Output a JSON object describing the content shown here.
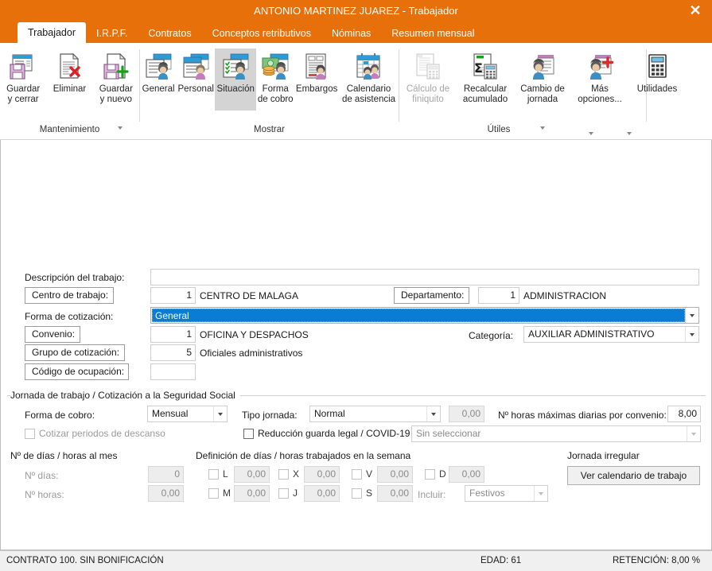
{
  "window": {
    "title": "ANTONIO MARTINEZ JUAREZ - Trabajador",
    "close_label": "✕",
    "accent_color": "#e8700a"
  },
  "tabs": [
    {
      "label": "Trabajador",
      "active": true
    },
    {
      "label": "I.R.P.F.",
      "active": false
    },
    {
      "label": "Contratos",
      "active": false
    },
    {
      "label": "Conceptos retributivos",
      "active": false
    },
    {
      "label": "Nóminas",
      "active": false
    },
    {
      "label": "Resumen mensual",
      "active": false
    }
  ],
  "ribbon": {
    "groups": [
      {
        "name": "Mantenimiento",
        "label": "Mantenimiento",
        "buttons": [
          {
            "id": "guardar-y-cerrar",
            "label": "Guardar\ny cerrar",
            "icon": "save-close-icon",
            "disabled": false,
            "selected": false,
            "dropdown": false
          },
          {
            "id": "eliminar",
            "label": "Eliminar",
            "icon": "delete-document-icon",
            "disabled": false,
            "selected": false,
            "dropdown": false
          },
          {
            "id": "guardar-y-nuevo",
            "label": "Guardar\ny nuevo",
            "icon": "save-new-icon",
            "disabled": false,
            "selected": false,
            "dropdown": true
          }
        ]
      },
      {
        "name": "Mostrar",
        "label": "Mostrar",
        "buttons": [
          {
            "id": "general",
            "label": "General",
            "icon": "person-card-icon",
            "disabled": false,
            "selected": false,
            "dropdown": false
          },
          {
            "id": "personal",
            "label": "Personal",
            "icon": "person-personal-icon",
            "disabled": false,
            "selected": false,
            "dropdown": false
          },
          {
            "id": "situacion",
            "label": "Situación",
            "icon": "person-checklist-icon",
            "disabled": false,
            "selected": true,
            "dropdown": false
          },
          {
            "id": "forma-de-cobro",
            "label": "Forma\nde cobro",
            "icon": "person-money-icon",
            "disabled": false,
            "selected": false,
            "dropdown": false
          },
          {
            "id": "embargos",
            "label": "Embargos",
            "icon": "embargo-doc-icon",
            "disabled": false,
            "selected": false,
            "dropdown": false
          },
          {
            "id": "calendario-de-asistencia",
            "label": "Calendario\nde asistencia",
            "icon": "calendar-people-icon",
            "disabled": false,
            "selected": false,
            "dropdown": false
          }
        ]
      },
      {
        "name": "Utiles",
        "label": "Útiles",
        "buttons": [
          {
            "id": "calculo-de-finiquito",
            "label": "Cálculo de\nfiniquito",
            "icon": "calc-doc-icon",
            "disabled": true,
            "selected": false,
            "dropdown": false
          },
          {
            "id": "recalcular-acumulado",
            "label": "Recalcular\nacumulado",
            "icon": "sigma-calc-icon",
            "disabled": false,
            "selected": false,
            "dropdown": false
          },
          {
            "id": "cambio-de-jornada",
            "label": "Cambio de\njornada",
            "icon": "person-list-icon",
            "disabled": false,
            "selected": false,
            "dropdown": true
          },
          {
            "id": "mas-opciones",
            "label": "Más\nopciones...",
            "icon": "person-plus-icon",
            "disabled": false,
            "selected": false,
            "dropdown": true
          },
          {
            "id": "utilidades",
            "label": "Utilidades",
            "icon": "calculator-icon",
            "disabled": false,
            "selected": false,
            "dropdown": true
          }
        ]
      }
    ]
  },
  "form": {
    "descripcion_label": "Descripción del trabajo:",
    "descripcion_value": "",
    "centro_trabajo_label": "Centro de trabajo:",
    "centro_trabajo_code": "1",
    "centro_trabajo_name": "CENTRO DE MALAGA",
    "departamento_label": "Departamento:",
    "departamento_code": "1",
    "departamento_name": "ADMINISTRACION",
    "forma_cotizacion_label": "Forma de cotización:",
    "forma_cotizacion_value": "General",
    "convenio_label": "Convenio:",
    "convenio_code": "1",
    "convenio_name": "OFICINA Y DESPACHOS",
    "categoria_label": "Categoría:",
    "categoria_value": "AUXILIAR ADMINISTRATIVO",
    "grupo_cotizacion_label": "Grupo de cotización:",
    "grupo_cotizacion_code": "5",
    "grupo_cotizacion_name": "Oficiales administrativos",
    "codigo_ocupacion_label": "Código de ocupación:",
    "codigo_ocupacion_value": ""
  },
  "jornada": {
    "section_title": "Jornada de trabajo / Cotización a la Seguridad Social",
    "forma_cobro_label": "Forma de cobro:",
    "forma_cobro_value": "Mensual",
    "tipo_jornada_label": "Tipo jornada:",
    "tipo_jornada_value": "Normal",
    "tipo_jornada_num": "0,00",
    "horas_max_label": "Nº horas máximas diarias por convenio:",
    "horas_max_value": "8,00",
    "cotizar_descanso_label": "Cotizar periodos de descanso",
    "cotizar_descanso_checked": false,
    "reduccion_label": "Reducción guarda legal / COVID-19",
    "reduccion_checked": false,
    "reduccion_select_value": "Sin seleccionar"
  },
  "dias_mes": {
    "section_title": "Nº de días / horas al mes",
    "dias_label": "Nº días:",
    "dias_value": "0",
    "horas_label": "Nº horas:",
    "horas_value": "0,00"
  },
  "semana": {
    "section_title": "Definición de días / horas trabajados en la semana",
    "days": [
      {
        "key": "L",
        "value": "0,00",
        "checked": false
      },
      {
        "key": "M",
        "value": "0,00",
        "checked": false
      },
      {
        "key": "X",
        "value": "0,00",
        "checked": false
      },
      {
        "key": "J",
        "value": "0,00",
        "checked": false
      },
      {
        "key": "V",
        "value": "0,00",
        "checked": false
      },
      {
        "key": "S",
        "value": "0,00",
        "checked": false
      },
      {
        "key": "D",
        "value": "0,00",
        "checked": false
      }
    ],
    "incluir_label": "Incluir:",
    "incluir_value": "Festivos"
  },
  "jornada_irregular": {
    "section_title": "Jornada irregular",
    "button_label": "Ver calendario de trabajo"
  },
  "statusbar": {
    "contrato": "CONTRATO 100.  SIN BONIFICACIÓN",
    "edad": "EDAD: 61",
    "retencion": "RETENCIÓN: 8,00 %"
  }
}
